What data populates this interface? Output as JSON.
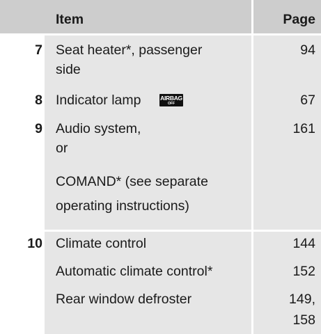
{
  "header": {
    "item": "Item",
    "page": "Page"
  },
  "rows": [
    {
      "num": "7",
      "item_lines": [
        "Seat heater*, passenger",
        "side"
      ],
      "page": "94"
    },
    {
      "num": "8",
      "item": "Indicator lamp",
      "icon": "airbag-off-indicator-icon",
      "icon_text": {
        "top": "AIRBAG",
        "bottom": "OFF"
      },
      "page": "67"
    },
    {
      "num": "9",
      "item_lines": [
        "Audio system,",
        "or"
      ],
      "page": "161",
      "sub_lines": [
        "COMAND* (see separate",
        "operating instructions)"
      ]
    },
    {
      "num": "10",
      "item": "Climate control",
      "page": "144"
    },
    {
      "num": "",
      "item": "Automatic climate control*",
      "page": "152"
    },
    {
      "num": "",
      "item": "Rear window defroster",
      "page_lines": [
        "149,",
        "158"
      ]
    }
  ]
}
